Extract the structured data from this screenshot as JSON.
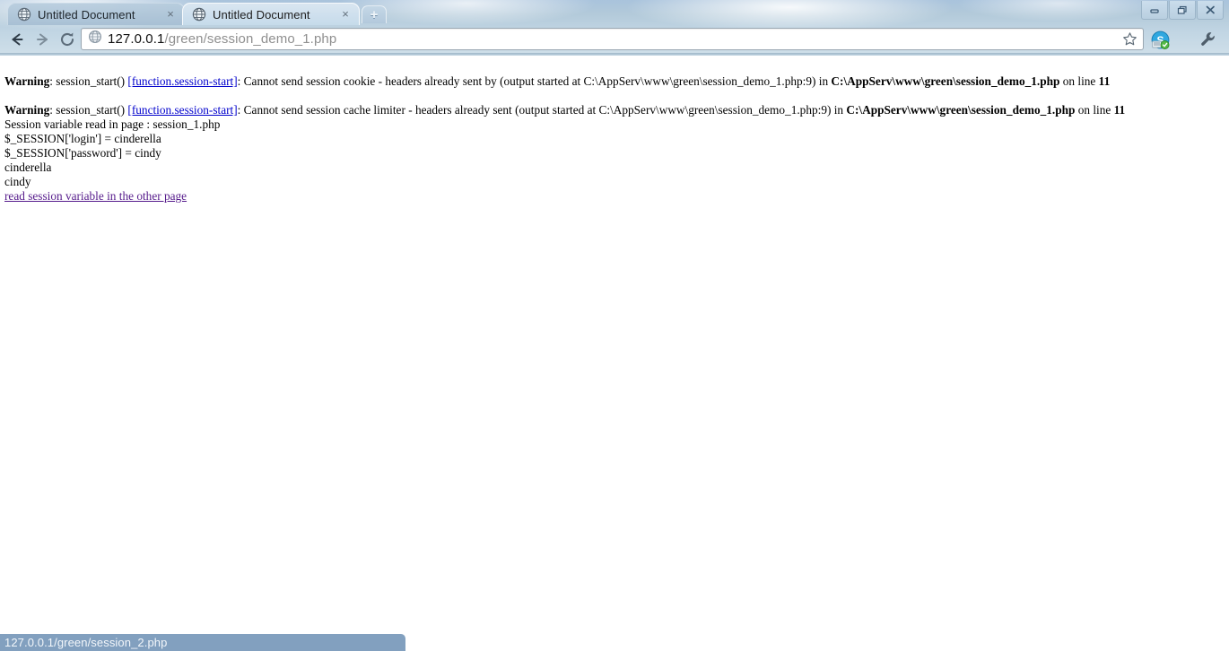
{
  "window": {
    "controls": [
      {
        "name": "minimize",
        "glyph": "minimize-icon"
      },
      {
        "name": "restore",
        "glyph": "restore-icon"
      },
      {
        "name": "close",
        "glyph": "close-icon"
      }
    ]
  },
  "tabs": [
    {
      "title": "Untitled Document",
      "favicon": "globe-icon",
      "close": "×",
      "active": false
    },
    {
      "title": "Untitled Document",
      "favicon": "globe-icon",
      "close": "×",
      "active": true
    }
  ],
  "new_tab": {
    "label": "+"
  },
  "toolbar": {
    "back_label": "Back",
    "forward_label": "Forward",
    "reload_label": "Reload",
    "page_icon": "globe-icon",
    "url_host": "127.0.0.1",
    "url_path": "/green/session_demo_1.php",
    "url_full": "127.0.0.1/green/session_demo_1.php",
    "bookmark_label": "Bookmark this page",
    "extension_label": "Skype click to call",
    "wrench_label": "Customize and control Google Chrome"
  },
  "page": {
    "warnings": [
      {
        "label": "Warning",
        "sep": ": ",
        "func": "session_start() ",
        "link": "[function.session-start]",
        "message": ": Cannot send session cookie - headers already sent by (output started at C:\\AppServ\\www\\green\\session_demo_1.php:9) in ",
        "path": "C:\\AppServ\\www\\green\\session_demo_1.php",
        "tail": " on line ",
        "line_no": "11"
      },
      {
        "label": "Warning",
        "sep": ": ",
        "func": "session_start() ",
        "link": "[function.session-start]",
        "message": ": Cannot send session cache limiter - headers already sent (output started at C:\\AppServ\\www\\green\\session_demo_1.php:9) in ",
        "path": "C:\\AppServ\\www\\green\\session_demo_1.php",
        "tail": " on line ",
        "line_no": "11"
      }
    ],
    "session_page_line": "Session variable read in page : session_1.php",
    "login_line": "$_SESSION['login'] = cinderella",
    "password_line": "$_SESSION['password'] = cindy",
    "login_value": "cinderella",
    "password_value": "cindy",
    "other_page_link": "read session variable in the other page"
  },
  "status": {
    "text": "127.0.0.1/green/session_2.php"
  },
  "colors": {
    "link_unvisited": "#0000cc",
    "link_visited": "#551a8b",
    "status_bg": "#82a0bf",
    "frame_top": "#a9c3dc",
    "active_tab": "#cfe0ee"
  }
}
